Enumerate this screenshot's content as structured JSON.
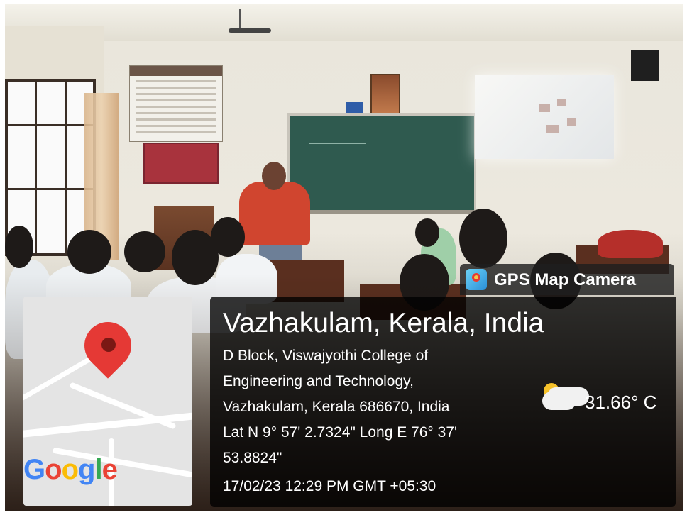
{
  "overlay": {
    "app_name": "GPS Map Camera",
    "place": "Vazhakulam, Kerala, India",
    "address_lines": [
      "D Block, Viswajyothi College of",
      "Engineering and Technology,",
      "Vazhakulam, Kerala 686670, India"
    ],
    "coordinate_lines": [
      "Lat N 9° 57' 2.7324\" Long E 76° 37'",
      "53.8824\""
    ],
    "timestamp": "17/02/23 12:29 PM GMT +05:30",
    "temperature": "31.66° C",
    "weather_icon": "partly-cloudy-icon",
    "app_icon": "gps-map-camera-icon"
  },
  "map": {
    "logo_text": "Google",
    "logo_colors": [
      "#4285F4",
      "#EA4335",
      "#FBBC05",
      "#4285F4",
      "#34A853",
      "#EA4335"
    ],
    "pin_icon": "map-pin-icon",
    "pin_color": "#E53935"
  }
}
